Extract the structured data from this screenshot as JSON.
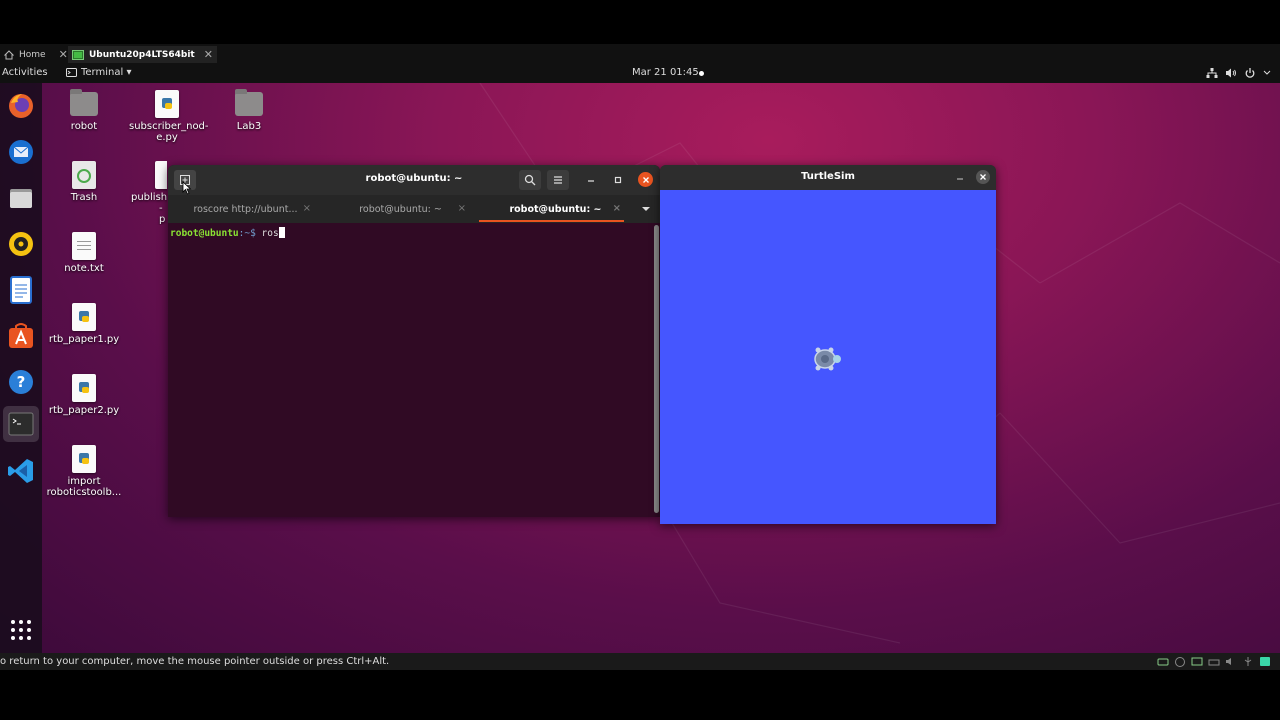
{
  "vm_tabs": {
    "home_label": "Home",
    "vm_label": "Ubuntu20p4LTS64bit",
    "close_glyph": "✕"
  },
  "topbar": {
    "activities": "Activities",
    "app_menu": "Terminal ▾",
    "clock": "Mar 21  01:45"
  },
  "desktop_icons": {
    "robot": "robot",
    "subscriber": "subscriber_nod-e.py",
    "lab3": "Lab3",
    "trash": "Trash",
    "publisher_a": "publishe",
    "publisher_b": "-p",
    "note": "note.txt",
    "rtb1": "rtb_paper1.py",
    "rtb2": "rtb_paper2.py",
    "import_a": "import",
    "import_b": "roboticstoolb..."
  },
  "terminal": {
    "title": "robot@ubuntu: ~",
    "tabs": [
      "roscore http://ubunt...",
      "robot@ubuntu: ~",
      "robot@ubuntu: ~"
    ],
    "tab_close": "×",
    "prompt_user": "robot@ubuntu",
    "prompt_rest": ":~$ ",
    "command": "ros"
  },
  "turtlesim": {
    "title": "TurtleSim",
    "background_color": "#4556ff"
  },
  "statusbar": {
    "message": "o return to your computer, move the mouse pointer outside or press Ctrl+Alt."
  },
  "colors": {
    "terminal_bg": "#300a24",
    "prompt_green": "#8ae234",
    "close_red": "#e95420"
  }
}
